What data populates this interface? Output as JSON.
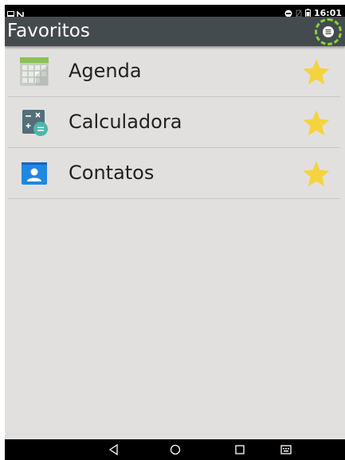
{
  "status_bar": {
    "time": "16:01",
    "icons": [
      "image-notification-icon",
      "n-notification-icon",
      "dnd-icon",
      "no-sim-icon",
      "battery-icon"
    ]
  },
  "app_bar": {
    "title": "Favoritos",
    "menu_icon": "menu-icon"
  },
  "favorites": [
    {
      "label": "Agenda",
      "icon": "calendar-icon",
      "starred": true
    },
    {
      "label": "Calculadora",
      "icon": "calculator-icon",
      "starred": true
    },
    {
      "label": "Contatos",
      "icon": "contacts-icon",
      "starred": true
    }
  ],
  "nav_bar": {
    "buttons": [
      "back-icon",
      "home-icon",
      "recents-icon",
      "keyboard-switch-icon"
    ]
  },
  "colors": {
    "app_bar": "#434b4e",
    "background": "#e1e0df",
    "star": "#f5d33f",
    "highlight": "#8ad13c"
  }
}
